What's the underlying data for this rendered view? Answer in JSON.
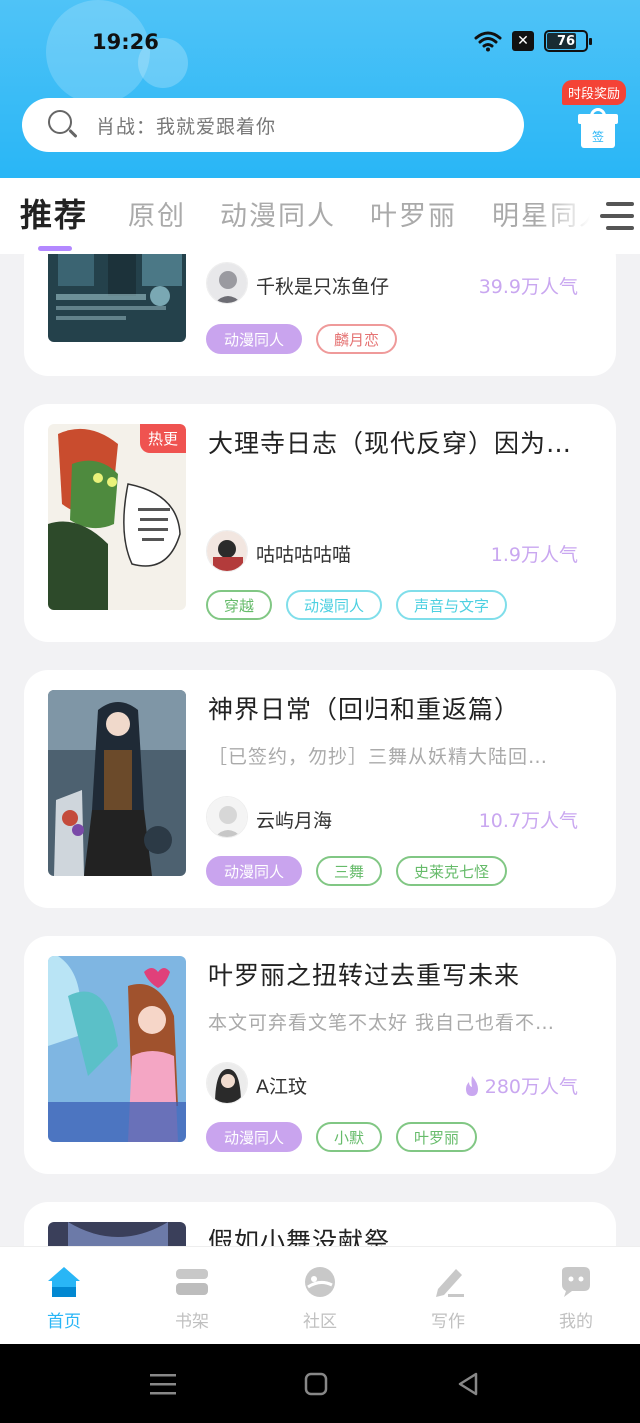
{
  "status_bar": {
    "time": "19:26",
    "battery": "76"
  },
  "search": {
    "placeholder": "肖战：我就爱跟着你"
  },
  "reward": {
    "badge": "时段奖励",
    "sign_label": "签"
  },
  "tabs": [
    {
      "label": "推荐",
      "active": true
    },
    {
      "label": "原创",
      "active": false
    },
    {
      "label": "动漫同人",
      "active": false
    },
    {
      "label": "叶罗丽",
      "active": false
    },
    {
      "label": "明星同人",
      "active": false
    }
  ],
  "books": [
    {
      "title": "",
      "description": "",
      "author": "千秋是只冻鱼仔",
      "popularity": "39.9万人气",
      "hot": false,
      "cover_tag": "",
      "tags": [
        {
          "label": "动漫同人",
          "style": "purple"
        },
        {
          "label": "麟月恋",
          "style": "red"
        }
      ],
      "colors": {
        "cover": "#2f4f5a"
      }
    },
    {
      "title": "大理寺日志（现代反穿）因为…",
      "description": "",
      "author": "咕咕咕咕喵",
      "popularity": "1.9万人气",
      "hot": false,
      "cover_tag": "热更",
      "tags": [
        {
          "label": "穿越",
          "style": "green"
        },
        {
          "label": "动漫同人",
          "style": "teal"
        },
        {
          "label": "声音与文字",
          "style": "teal"
        }
      ],
      "colors": {
        "cover": "#3d6b3a"
      }
    },
    {
      "title": "神界日常（回归和重返篇）",
      "description": "［已签约，勿抄］三舞从妖精大陆回…",
      "author": "云屿月海",
      "popularity": "10.7万人气",
      "hot": false,
      "cover_tag": "",
      "tags": [
        {
          "label": "动漫同人",
          "style": "purple"
        },
        {
          "label": "三舞",
          "style": "green"
        },
        {
          "label": "史莱克七怪",
          "style": "green"
        }
      ],
      "colors": {
        "cover": "#5a6d7e"
      }
    },
    {
      "title": "叶罗丽之扭转过去重写未来",
      "description": "本文可弃看文笔不太好 我自己也看不…",
      "author": "A江玟",
      "popularity": "280万人气",
      "hot": true,
      "cover_tag": "",
      "tags": [
        {
          "label": "动漫同人",
          "style": "purple"
        },
        {
          "label": "小默",
          "style": "green"
        },
        {
          "label": "叶罗丽",
          "style": "green"
        }
      ],
      "colors": {
        "cover": "#6aa9d8"
      }
    },
    {
      "title": "假如小舞没献祭",
      "description": "",
      "author": "",
      "popularity": "",
      "hot": false,
      "cover_tag": "",
      "tags": [],
      "colors": {
        "cover": "#3a3f5a"
      }
    }
  ],
  "bottom_nav": [
    {
      "label": "首页",
      "icon": "home-icon",
      "active": true
    },
    {
      "label": "书架",
      "icon": "bookshelf-icon",
      "active": false
    },
    {
      "label": "社区",
      "icon": "community-icon",
      "active": false
    },
    {
      "label": "写作",
      "icon": "write-icon",
      "active": false
    },
    {
      "label": "我的",
      "icon": "profile-icon",
      "active": false
    }
  ],
  "theme": {
    "accent": "#29b6f6",
    "tab_underline": "#b388ff",
    "popularity": "#c9a7f0"
  }
}
